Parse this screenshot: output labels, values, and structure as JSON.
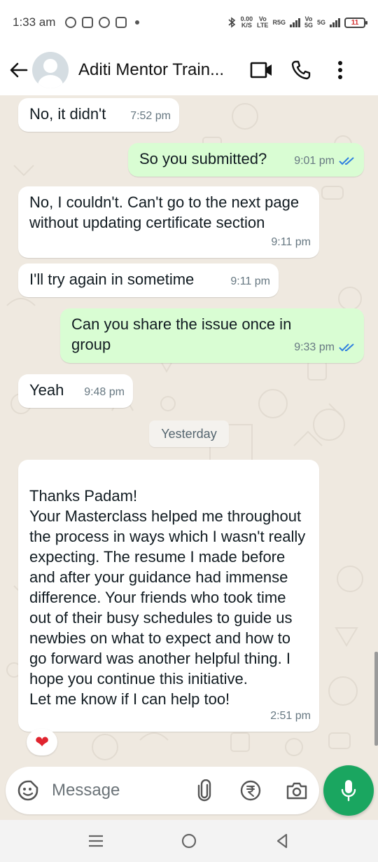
{
  "status_bar": {
    "time": "1:33 am",
    "net_speed_top": "0.00",
    "net_speed_bottom": "K/S",
    "sim1_top": "Vo",
    "sim1_bottom": "LTE",
    "sim1_label": "R5G",
    "sim2_top": "Vo",
    "sim2_bottom": "5G",
    "sim2_label": "5G",
    "battery": "11"
  },
  "header": {
    "title": "Aditi Mentor Train..."
  },
  "messages": [
    {
      "text": "No, it didn't",
      "time": "7:52 pm",
      "direction": "in"
    },
    {
      "text": "So you submitted?",
      "time": "9:01 pm",
      "direction": "out"
    },
    {
      "text": "No, I couldn't. Can't go to the next page without updating certificate section",
      "time": "9:11 pm",
      "direction": "in"
    },
    {
      "text": "I'll try again in sometime",
      "time": "9:11 pm",
      "direction": "in"
    },
    {
      "text": "Can you share the issue once in group",
      "time": "9:33 pm",
      "direction": "out"
    },
    {
      "text": "Yeah",
      "time": "9:48 pm",
      "direction": "in"
    },
    {
      "text": "Thanks Padam!\nYour Masterclass helped me throughout the process in ways which I wasn't really expecting. The resume I made before and after your guidance had immense difference. Your friends who took time out of their busy schedules to guide us newbies on what to expect and how to go forward was another helpful thing. I hope you continue this initiative.\nLet me know if I can help too!",
      "time": "2:51 pm",
      "direction": "in"
    }
  ],
  "date_separator": "Yesterday",
  "reaction": "❤",
  "composer": {
    "placeholder": "Message"
  },
  "colors": {
    "incoming_bubble": "#ffffff",
    "outgoing_bubble": "#d9fdd3",
    "accent_green": "#1aa660",
    "read_ticks": "#2f7fe0",
    "chat_background": "#efe9e0"
  },
  "icons": [
    "back-arrow-icon",
    "avatar-placeholder-icon",
    "video-call-icon",
    "phone-icon",
    "more-vert-icon",
    "sticker-icon",
    "attach-icon",
    "rupee-payment-icon",
    "camera-icon",
    "mic-icon",
    "nav-menu-icon",
    "nav-home-icon",
    "nav-back-icon",
    "heart-reaction-icon",
    "double-tick-icon"
  ]
}
